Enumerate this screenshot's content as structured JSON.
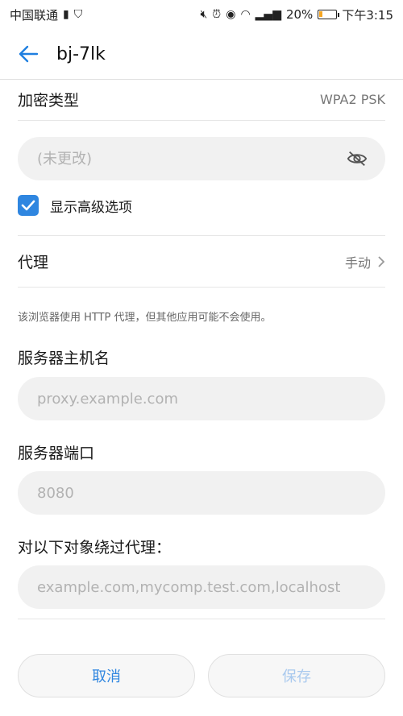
{
  "status_bar": {
    "carrier": "中国联通",
    "battery": "20%",
    "time": "下午3:15",
    "battery_level": 0.2
  },
  "header": {
    "back_icon": "arrow-left-icon",
    "title": "bj-7lk"
  },
  "security": {
    "label": "加密类型",
    "value": "WPA2 PSK"
  },
  "password": {
    "placeholder": "(未更改)",
    "visibility_icon": "eye-off-icon"
  },
  "advanced": {
    "checked": true,
    "label": "显示高级选项"
  },
  "proxy": {
    "label": "代理",
    "value": "手动",
    "note": "该浏览器使用 HTTP 代理，但其他应用可能不会使用。"
  },
  "hostname": {
    "label": "服务器主机名",
    "placeholder": "proxy.example.com"
  },
  "port": {
    "label": "服务器端口",
    "placeholder": "8080"
  },
  "bypass": {
    "label": "对以下对象绕过代理：",
    "placeholder": "example.com,mycomp.test.com,localhost"
  },
  "actions": {
    "cancel": "取消",
    "save": "保存"
  },
  "colors": {
    "accent": "#2f86e0",
    "battery_fill": "#f5a623"
  }
}
